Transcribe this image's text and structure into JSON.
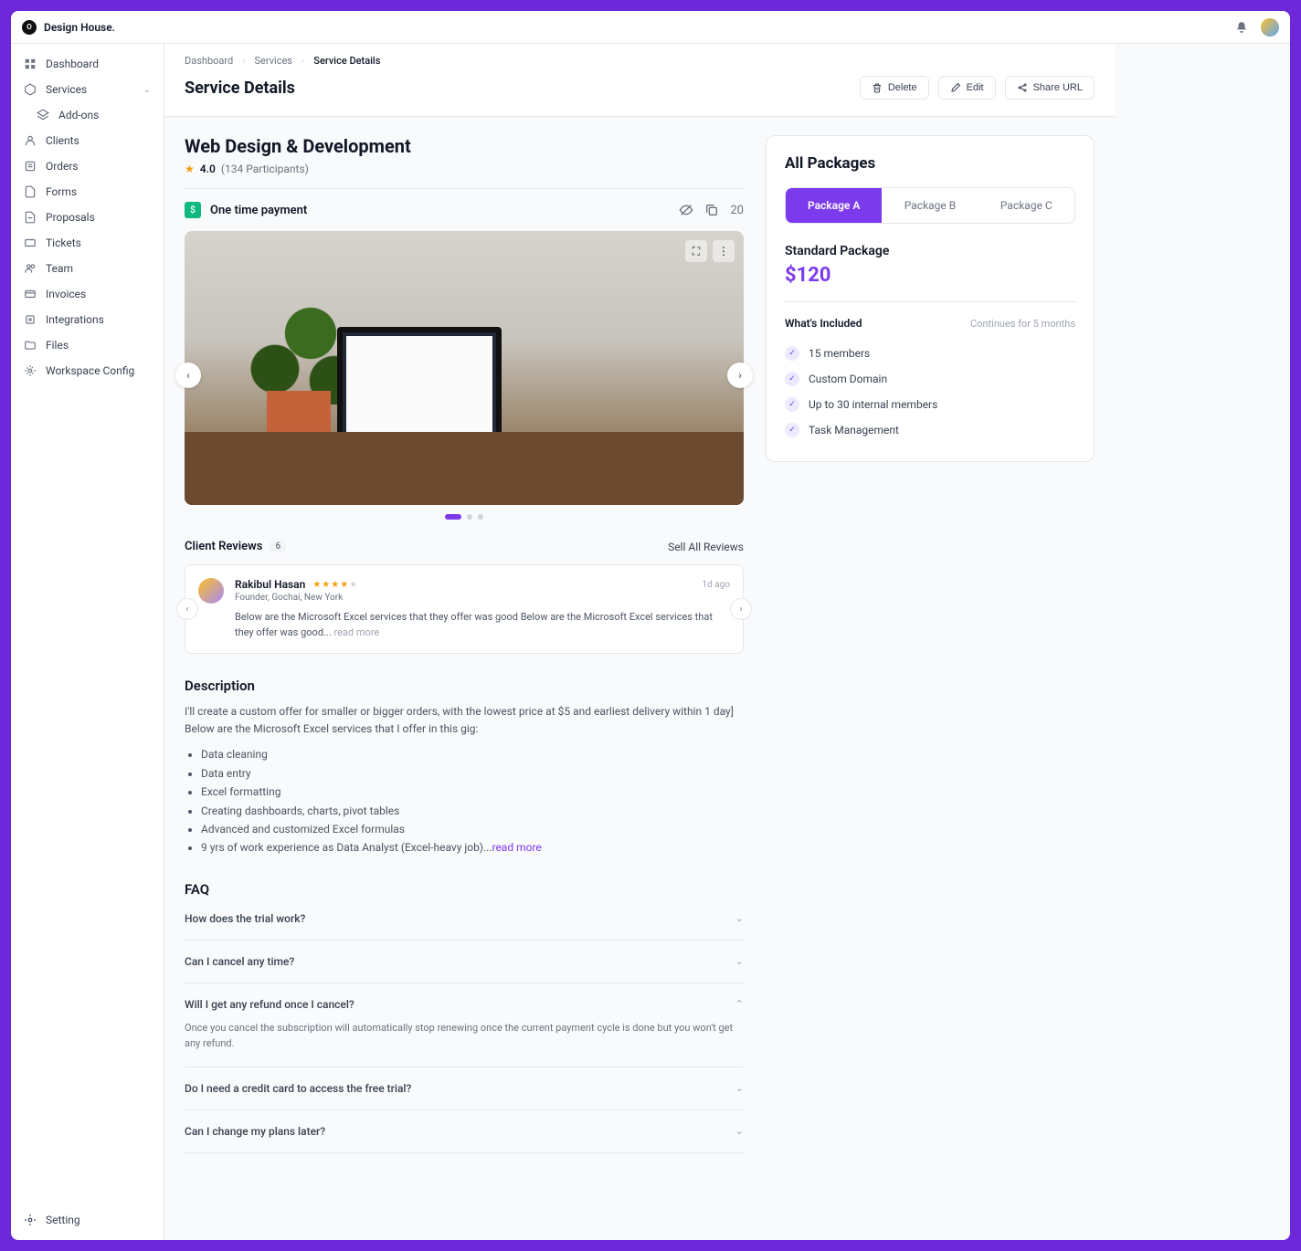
{
  "brand": "Design House.",
  "brand_logo_letter": "O",
  "sidebar": {
    "items": [
      {
        "label": "Dashboard"
      },
      {
        "label": "Services"
      },
      {
        "label": "Add-ons"
      },
      {
        "label": "Clients"
      },
      {
        "label": "Orders"
      },
      {
        "label": "Forms"
      },
      {
        "label": "Proposals"
      },
      {
        "label": "Tickets"
      },
      {
        "label": "Team"
      },
      {
        "label": "Invoices"
      },
      {
        "label": "Integrations"
      },
      {
        "label": "Files"
      },
      {
        "label": "Workspace Config"
      }
    ],
    "footer": "Setting"
  },
  "breadcrumb": {
    "a": "Dashboard",
    "b": "Services",
    "c": "Service Details"
  },
  "page_title": "Service Details",
  "actions": {
    "delete": "Delete",
    "edit": "Edit",
    "share": "Share URL"
  },
  "service": {
    "title": "Web Design & Development",
    "rating": "4.0",
    "participants": "(134 Participants)",
    "payment_type": "One time payment",
    "view_count": "20"
  },
  "reviews": {
    "heading": "Client Reviews",
    "count": "6",
    "link": "Sell All Reviews",
    "item": {
      "name": "Rakibul Hasan",
      "time": "1d ago",
      "sub": "Founder, Gochai, New York",
      "text": "Below are the Microsoft Excel services that they offer was good Below are the Microsoft Excel services that they offer was good... ",
      "readmore": "read more"
    }
  },
  "description": {
    "title": "Description",
    "intro": "I'll create a custom offer for smaller or bigger orders, with the lowest price at $5 and earliest delivery within 1 day] Below are the Microsoft Excel services that I offer in this gig:",
    "items": [
      "Data cleaning",
      "Data entry",
      "Excel formatting",
      "Creating dashboards, charts, pivot tables",
      "Advanced and customized Excel formulas"
    ],
    "last_prefix": "9 yrs of work experience as Data Analyst (Excel-heavy job)...",
    "readmore": "read more"
  },
  "faq": {
    "title": "FAQ",
    "items": [
      {
        "q": "How does the trial work?",
        "open": false
      },
      {
        "q": "Can I cancel any time?",
        "open": false
      },
      {
        "q": "Will I get any refund once I cancel?",
        "open": true,
        "a": "Once you cancel the subscription will automatically stop renewing once the current payment cycle is done but you won't get any refund."
      },
      {
        "q": "Do I need a credit card to access the free trial?",
        "open": false
      },
      {
        "q": "Can I change my plans later?",
        "open": false
      }
    ]
  },
  "packages": {
    "title": "All Packages",
    "tabs": [
      "Package A",
      "Package B",
      "Package C"
    ],
    "selected": {
      "name": "Standard Package",
      "price": "$120",
      "included_label": "What's Included",
      "duration": "Continues for 5 months",
      "features": [
        "15 members",
        "Custom Domain",
        "Up to 30 internal members",
        "Task Management"
      ]
    }
  }
}
